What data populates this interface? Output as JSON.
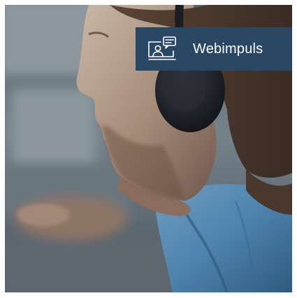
{
  "badge": {
    "label": "Webimpuls",
    "icon": "webinar-presenter-icon",
    "background": "#2a4763"
  },
  "photo": {
    "subject": "man-with-headset-photo"
  }
}
